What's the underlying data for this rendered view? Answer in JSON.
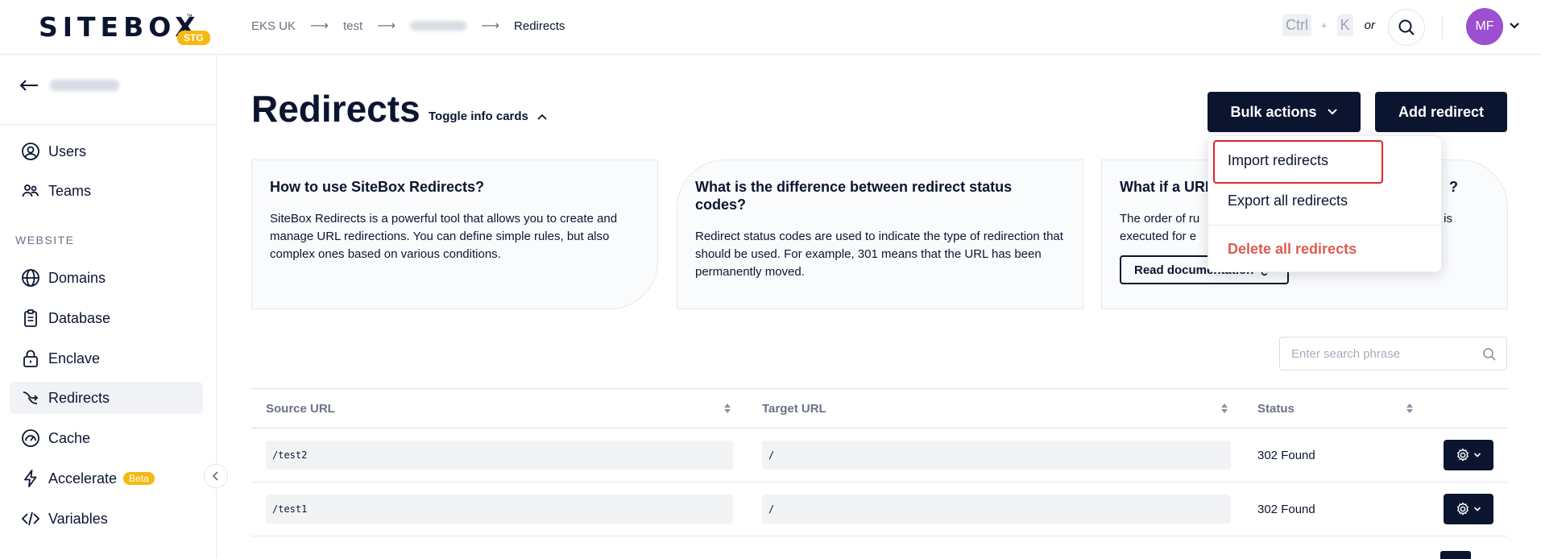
{
  "header": {
    "logo_text": "SITEBOX",
    "logo_tm": "™",
    "env_badge": "STG",
    "breadcrumb": [
      "EKS UK",
      "test",
      "Redirects"
    ],
    "shortcut_key1": "Ctrl",
    "shortcut_plus": "+",
    "shortcut_key2": "K",
    "shortcut_or": "or",
    "avatar_initials": "MF"
  },
  "sidebar": {
    "items_top": [
      {
        "label": "Users",
        "icon": "user-circle-icon"
      },
      {
        "label": "Teams",
        "icon": "teams-icon"
      }
    ],
    "section_label": "WEBSITE",
    "items": [
      {
        "label": "Domains",
        "icon": "globe-icon"
      },
      {
        "label": "Database",
        "icon": "clipboard-icon"
      },
      {
        "label": "Enclave",
        "icon": "lock-icon"
      },
      {
        "label": "Redirects",
        "icon": "redirect-icon",
        "active": true
      },
      {
        "label": "Cache",
        "icon": "gauge-icon"
      },
      {
        "label": "Accelerate",
        "icon": "bolt-icon",
        "badge": "Beta"
      },
      {
        "label": "Variables",
        "icon": "code-icon"
      }
    ]
  },
  "main": {
    "title": "Redirects",
    "toggle_info": "Toggle info cards",
    "bulk_actions": "Bulk actions",
    "add_redirect": "Add redirect",
    "cards": [
      {
        "title": "How to use SiteBox Redirects?",
        "body": "SiteBox Redirects is a powerful tool that allows you to create and manage URL redirections. You can define simple rules, but also complex ones based on various conditions."
      },
      {
        "title": "What is the difference between redirect status codes?",
        "body": "Redirect status codes are used to indicate the type of redirection that should be used. For example, 301 means that the URL has been permanently moved."
      },
      {
        "title": "What if a URL",
        "title_end": "?",
        "body": "The order of ru",
        "body_end": "is",
        "body2": "executed for e",
        "button": "Read documentation"
      }
    ],
    "dropdown": {
      "items": [
        "Import redirects",
        "Export all redirects"
      ],
      "danger": "Delete all redirects"
    },
    "search_placeholder": "Enter search phrase",
    "table": {
      "columns": [
        "Source URL",
        "Target URL",
        "Status"
      ],
      "rows": [
        {
          "source": "/test2",
          "target": "/",
          "status": "302 Found"
        },
        {
          "source": "/test1",
          "target": "/",
          "status": "302 Found"
        }
      ]
    }
  }
}
